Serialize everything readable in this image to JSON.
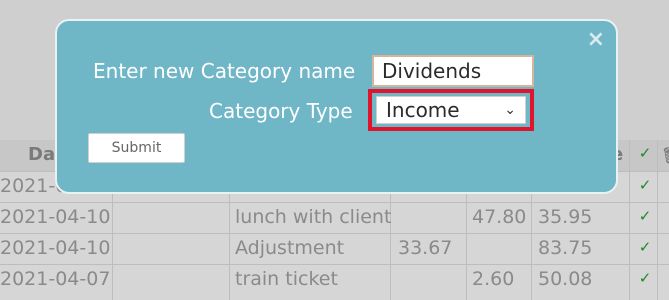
{
  "modal": {
    "close_symbol": "×",
    "name_label": "Enter new Category name",
    "name_value": "Dividends",
    "type_label": "Category Type",
    "type_selected": "Income",
    "chevron_symbol": "⌄",
    "submit_label": "Submit",
    "highlight_color": "#e0152d"
  },
  "table": {
    "header_date_fragment": "Da",
    "header_e_fragment": "e",
    "check_symbol": "✓",
    "trash_symbol": "🗑",
    "rows": [
      {
        "date": "2021-0",
        "description": "",
        "in": "",
        "out": "",
        "balance": ""
      },
      {
        "date": "2021-04-10",
        "description": "lunch with client",
        "in": "",
        "out": "47.80",
        "balance": "35.95"
      },
      {
        "date": "2021-04-10",
        "description": "Adjustment",
        "in": "33.67",
        "out": "",
        "balance": "83.75"
      },
      {
        "date": "2021-04-07",
        "description": "train ticket",
        "in": "",
        "out": "2.60",
        "balance": "50.08"
      }
    ]
  }
}
